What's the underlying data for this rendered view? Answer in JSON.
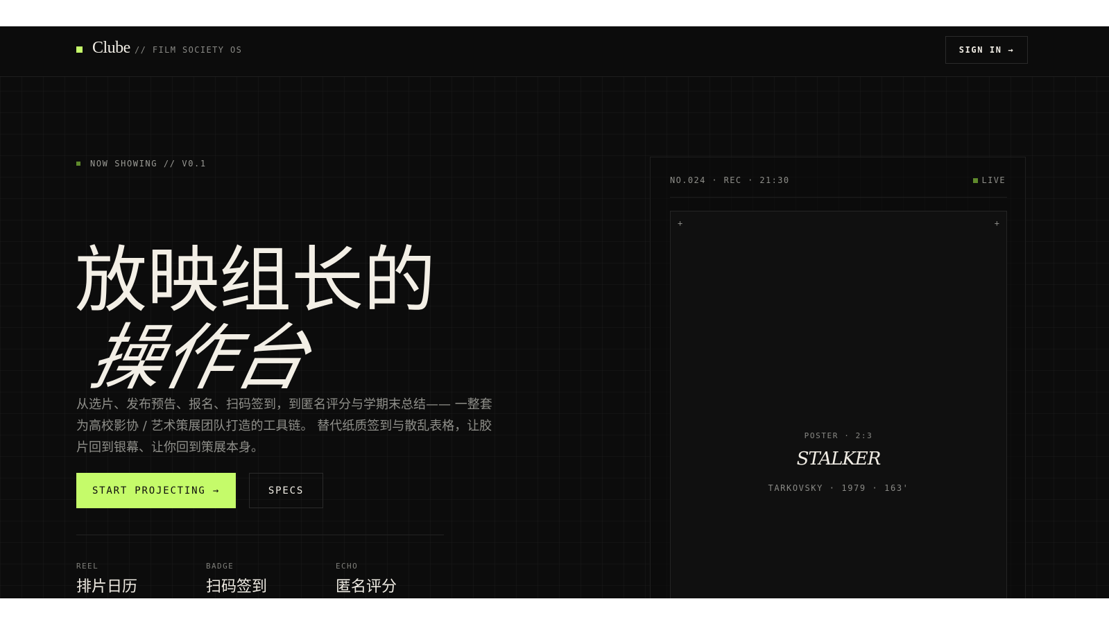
{
  "header": {
    "brand_name": "Clube",
    "brand_tag": "// FILM SOCIETY OS",
    "sign_in_label": "SIGN IN →"
  },
  "hero": {
    "eyebrow": "NOW SHOWING // V0.1",
    "headline_line1": "放映组长的",
    "headline_line2": "操作台",
    "lead": "从选片、发布预告、报名、扫码签到，到匿名评分与学期末总结—— 一整套为高校影协 / 艺术策展团队打造的工具链。 替代纸质签到与散乱表格，让胶片回到银幕、让你回到策展本身。",
    "primary_cta": "START PROJECTING →",
    "secondary_cta": "SPECS",
    "stats": [
      {
        "key": "REEL",
        "value": "排片日历"
      },
      {
        "key": "BADGE",
        "value": "扫码签到"
      },
      {
        "key": "ECHO",
        "value": "匿名评分"
      }
    ]
  },
  "card": {
    "meta": "NO.024 · REC · 21:30",
    "live_label": "LIVE",
    "corner_mark": "+",
    "poster_ratio": "POSTER · 2:3",
    "poster_title": "STALKER",
    "poster_credit": "TARKOVSKY · 1979 · 163'"
  },
  "colors": {
    "background": "#0c0c0c",
    "accent": "#c5fb6a",
    "live_indicator": "#5f8a2c",
    "text_primary": "#f1ede5",
    "text_muted": "#8f8f8a"
  }
}
